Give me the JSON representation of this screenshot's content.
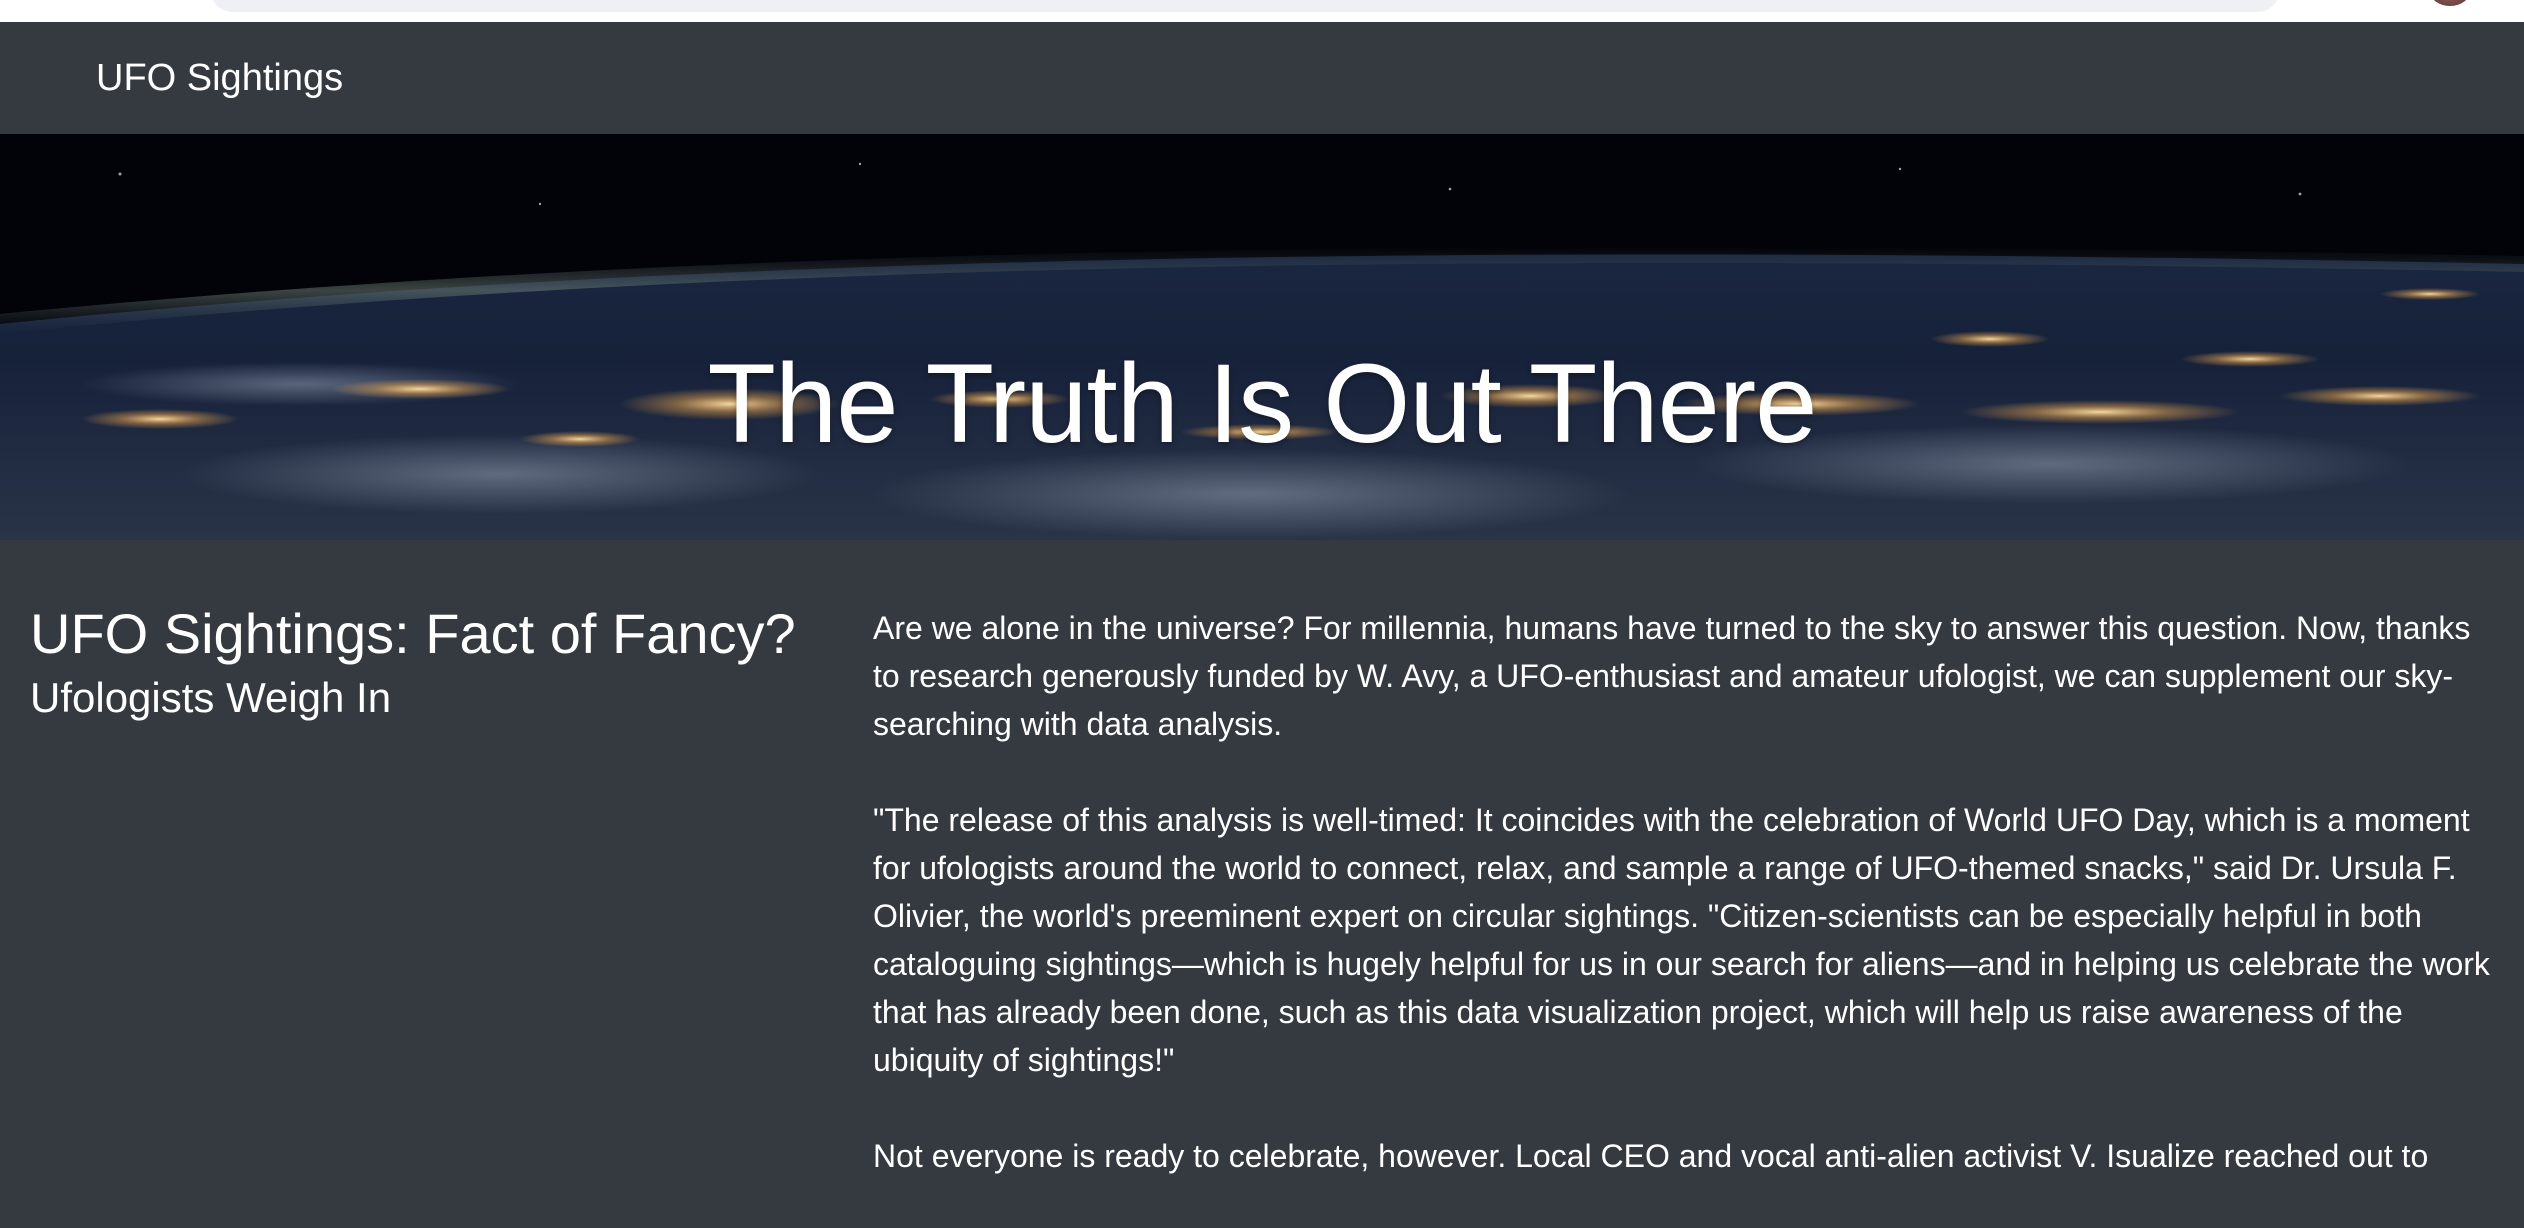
{
  "nav": {
    "brand": "UFO Sightings"
  },
  "hero": {
    "title": "The Truth Is Out There"
  },
  "article": {
    "title": "UFO Sightings: Fact of Fancy?",
    "subtitle": "Ufologists Weigh In",
    "paragraphs": [
      "Are we alone in the universe? For millennia, humans have turned to the sky to answer this question. Now, thanks to research generously funded by W. Avy, a UFO-enthusiast and amateur ufologist, we can supplement our sky-searching with data analysis.",
      "\"The release of this analysis is well-timed: It coincides with the celebration of World UFO Day, which is a moment for ufologists around the world to connect, relax, and sample a range of UFO-themed snacks,\" said Dr. Ursula F. Olivier, the world's preeminent expert on circular sightings. \"Citizen-scientists can be especially helpful in both cataloguing sightings—which is hugely helpful for us in our search for aliens—and in helping us celebrate the work that has already been done, such as this data visualization project, which will help us raise awareness of the ubiquity of sightings!\"",
      "Not everyone is ready to celebrate, however. Local CEO and vocal anti-alien activist V. Isualize reached out to"
    ]
  },
  "colors": {
    "page_background": "#343a40",
    "text": "#ffffff"
  },
  "icons": {
    "avatar": "user-avatar"
  }
}
